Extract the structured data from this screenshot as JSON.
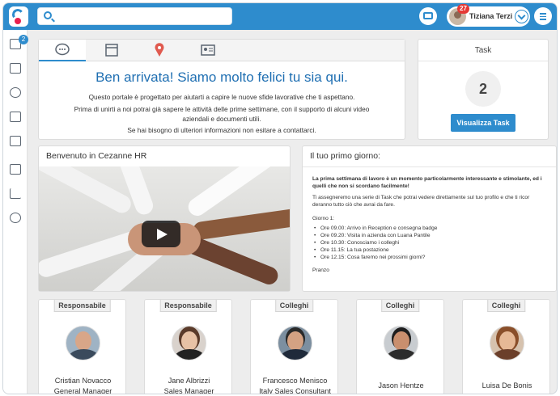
{
  "header": {
    "search": {
      "placeholder": "",
      "value": ""
    },
    "user": {
      "name": "Tiziana Terzi",
      "notifications": "27"
    }
  },
  "sidebar": {
    "items": [
      {
        "icon": "tasks-icon",
        "badge": "2"
      },
      {
        "icon": "calendar-icon"
      },
      {
        "icon": "people-icon"
      },
      {
        "icon": "org-chart-icon"
      },
      {
        "icon": "book-icon"
      },
      {
        "icon": "documents-icon"
      },
      {
        "icon": "bar-chart-icon"
      },
      {
        "icon": "chat-icon"
      }
    ]
  },
  "welcome": {
    "tabs": [
      {
        "icon": "chat-bubble-icon",
        "active": true
      },
      {
        "icon": "calendar-icon"
      },
      {
        "icon": "map-pin-icon"
      },
      {
        "icon": "id-card-icon"
      }
    ],
    "title": "Ben arrivata! Siamo molto felici tu sia qui.",
    "line1": "Questo portale è progettato per aiutarti a capire le nuove sfide lavorative che ti aspettano.",
    "line2": "Prima di unirti a noi potrai già sapere le attività delle prime settimane, con il supporto di alcuni video",
    "line3": "aziendali e documenti utili.",
    "line4": "Se hai bisogno di ulteriori informazioni non esitare a contattarci."
  },
  "task": {
    "title": "Task",
    "count": "2",
    "button": "Visualizza Task"
  },
  "video": {
    "title": "Benvenuto in Cezanne HR"
  },
  "first_day": {
    "title": "Il tuo primo giorno:",
    "intro": "La prima settimana di lavoro è un momento particolarmente interessante e stimolante, ed i quelli che non si scordano facilmente!",
    "para": "Ti assegneremo una serie di Task che potrai vedere direttamente sul tuo profilo e che ti ricor deranno tutto ciò che avrai da fare.",
    "day": "Giorno 1:",
    "schedule": [
      "Ore 09.00: Arrivo in Reception e consegna badge",
      "Ore 09.20: Visita in azienda con Luana Pantile",
      "Ore 10.30: Conosciamo i colleghi",
      "Ore 11.15: La tua postazione",
      "Ore 12.15: Cosa faremo nei prossimi giorni?"
    ],
    "lunch": "Pranzo"
  },
  "people": [
    {
      "role": "Responsabile",
      "name": "Cristian Novacco",
      "title": "General Manager"
    },
    {
      "role": "Responsabile",
      "name": "Jane Albrizzi",
      "title": "Sales Manager"
    },
    {
      "role": "Colleghi",
      "name": "Francesco Menisco",
      "title": "Italy Sales Consultant"
    },
    {
      "role": "Colleghi",
      "name": "Jason Hentze",
      "title": ""
    },
    {
      "role": "Colleghi",
      "name": "Luisa De Bonis",
      "title": ""
    }
  ]
}
